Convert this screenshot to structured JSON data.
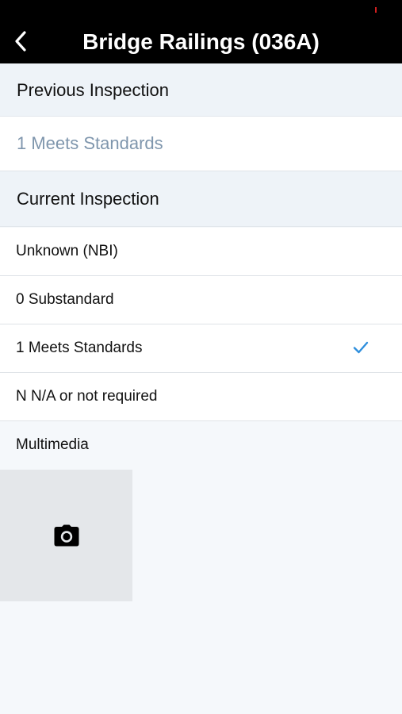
{
  "header": {
    "title": "Bridge Railings (036A)",
    "back_icon": "chevron-left-icon",
    "background": "#000000"
  },
  "previous_inspection": {
    "heading": "Previous Inspection",
    "value": "1 Meets Standards"
  },
  "current_inspection": {
    "heading": "Current Inspection",
    "options": [
      {
        "label": "Unknown (NBI)",
        "selected": false
      },
      {
        "label": "0 Substandard",
        "selected": false
      },
      {
        "label": "1 Meets Standards",
        "selected": true
      },
      {
        "label": "N N/A or not required",
        "selected": false
      }
    ],
    "selected_icon": "checkmark-icon",
    "accent": "#2f8fdd"
  },
  "multimedia": {
    "label": "Multimedia",
    "add_icon": "camera-icon"
  }
}
